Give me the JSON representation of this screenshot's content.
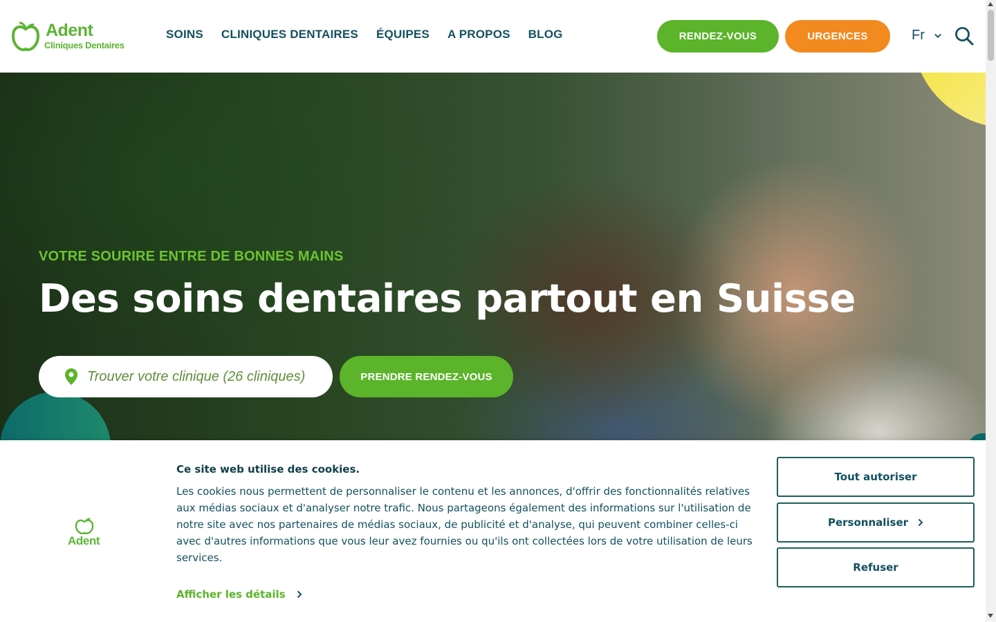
{
  "brand": {
    "name": "Adent",
    "tagline": "Cliniques Dentaires",
    "colors": {
      "green": "#5bb42a",
      "orange": "#f28a1f",
      "teal": "#12505f",
      "yellow": "#f5e23a"
    }
  },
  "nav": {
    "items": [
      "SOINS",
      "CLINIQUES DENTAIRES",
      "ÉQUIPES",
      "A PROPOS",
      "BLOG"
    ]
  },
  "header": {
    "rdv_label": "RENDEZ-VOUS",
    "urgences_label": "URGENCES",
    "language": "Fr",
    "icons": {
      "language_toggle": "chevron-down-icon",
      "search": "search-icon"
    }
  },
  "hero": {
    "kicker": "VOTRE SOURIRE ENTRE DE BONNES MAINS",
    "headline": "Des soins dentaires partout en Suisse",
    "finder_text": "Trouver votre clinique (26 cliniques)",
    "finder_icon": "map-pin-icon",
    "book_label": "PRENDRE RENDEZ-VOUS"
  },
  "cookie": {
    "logo_text": "Adent",
    "title": "Ce site web utilise des cookies.",
    "body": "Les cookies nous permettent de personnaliser le contenu et les annonces, d'offrir des fonctionnalités relatives aux médias sociaux et d'analyser notre trafic. Nous partageons également des informations sur l'utilisation de notre site avec nos partenaires de médias sociaux, de publicité et d'analyse, qui peuvent combiner celles-ci avec d'autres informations que vous leur avez fournies ou qu'ils ont collectées lors de votre utilisation de leurs services.",
    "details_label": "Afficher les détails",
    "allow_all_label": "Tout autoriser",
    "customize_label": "Personnaliser",
    "refuse_label": "Refuser"
  }
}
